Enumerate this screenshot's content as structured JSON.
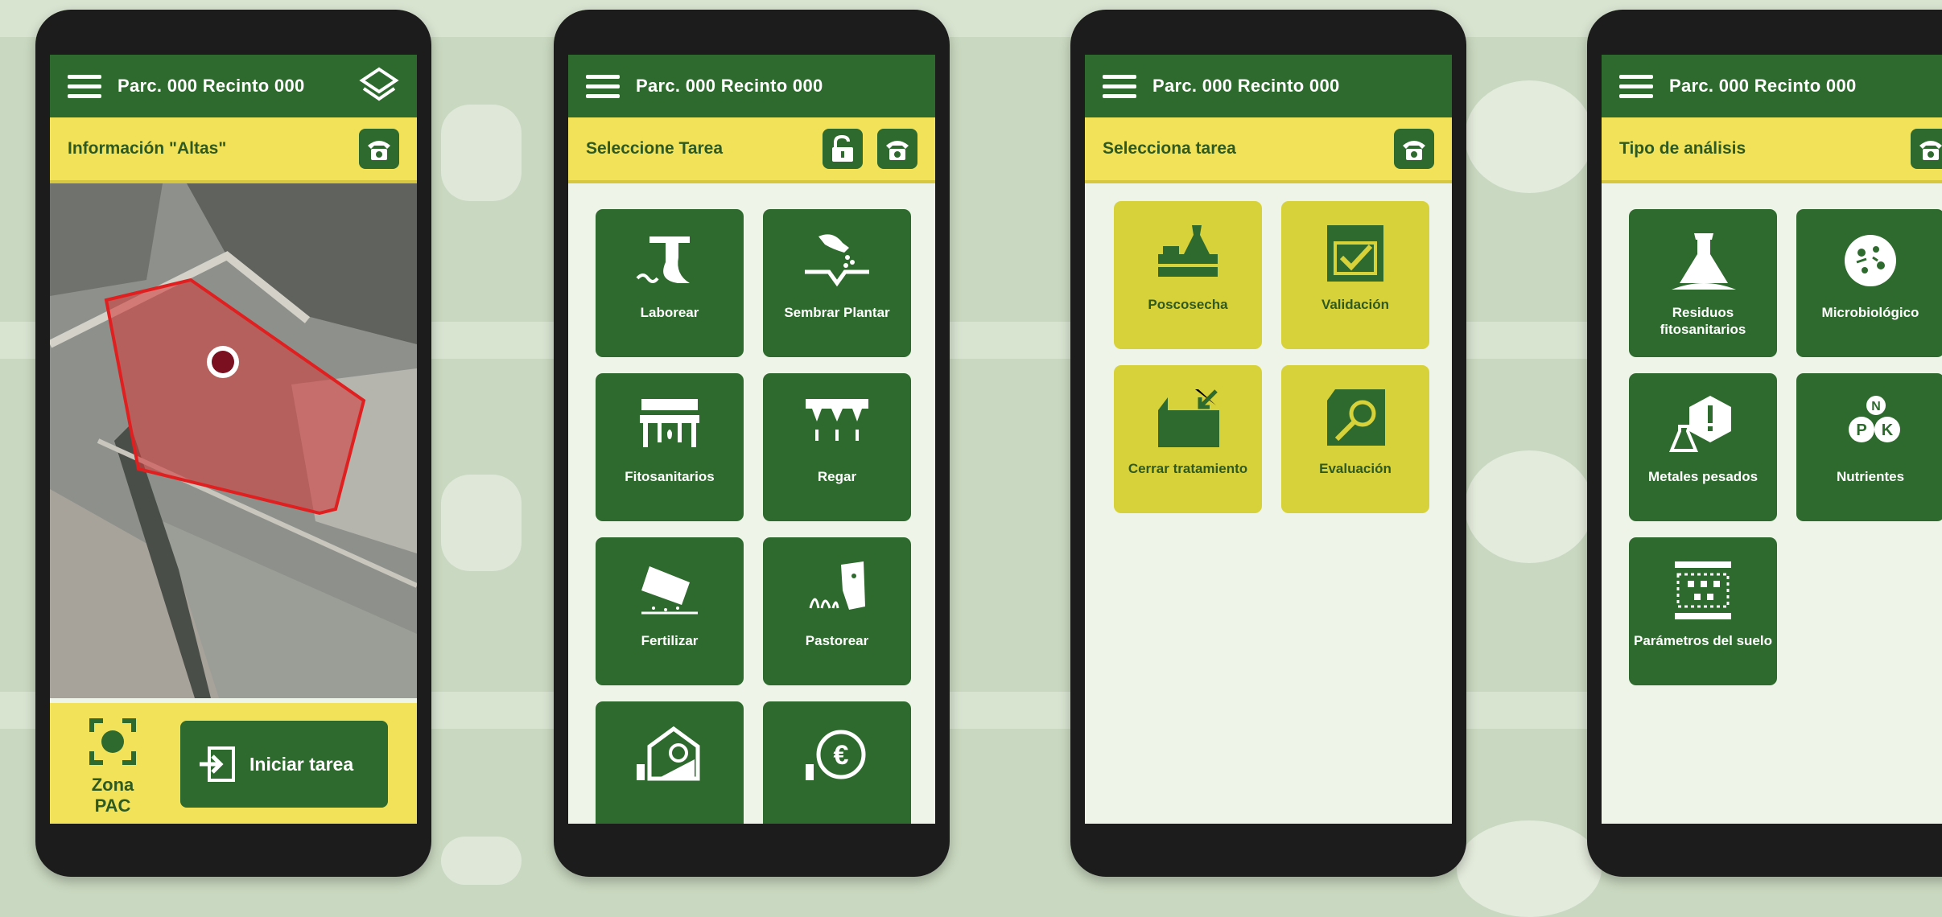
{
  "colors": {
    "dark_green": "#2e6a2e",
    "yellow": "#f1e25a",
    "tile_yellow": "#d8d23a",
    "background": "#c9d8c0",
    "red_parcel": "#d04040"
  },
  "phones": [
    {
      "header": {
        "title": "Parc. 000 Recinto 000"
      },
      "subheader": {
        "title": "Información \"Altas\""
      },
      "footer": {
        "zone_label_line1": "Zona",
        "zone_label_line2": "PAC",
        "start_button": "Iniciar tarea"
      }
    },
    {
      "header": {
        "title": "Parc. 000 Recinto 000"
      },
      "subheader": {
        "title": "Seleccione Tarea"
      },
      "tiles": [
        {
          "label": "Laborear",
          "icon": "plow-icon"
        },
        {
          "label": "Sembrar Plantar",
          "icon": "sow-icon"
        },
        {
          "label": "Fitosanitarios",
          "icon": "sprayer-icon"
        },
        {
          "label": "Regar",
          "icon": "irrigation-icon"
        },
        {
          "label": "Fertilizar",
          "icon": "fertilizer-icon"
        },
        {
          "label": "Pastorear",
          "icon": "grazing-icon"
        },
        {
          "label": "",
          "icon": "storage-icon"
        },
        {
          "label": "",
          "icon": "subsidy-icon"
        }
      ]
    },
    {
      "header": {
        "title": "Parc. 000 Recinto 000"
      },
      "subheader": {
        "title": "Selecciona tarea"
      },
      "tiles": [
        {
          "label": "Poscosecha",
          "icon": "postharvest-icon"
        },
        {
          "label": "Validación",
          "icon": "validation-icon"
        },
        {
          "label": "Cerrar tratamiento",
          "icon": "close-treatment-icon"
        },
        {
          "label": "Evaluación",
          "icon": "evaluation-icon"
        }
      ]
    },
    {
      "header": {
        "title": "Parc. 000 Recinto 000"
      },
      "subheader": {
        "title": "Tipo de análisis"
      },
      "tiles": [
        {
          "label": "Residuos fitosanitarios",
          "icon": "flask-icon"
        },
        {
          "label": "Microbiológico",
          "icon": "microbe-icon"
        },
        {
          "label": "Metales pesados",
          "icon": "heavy-metals-icon"
        },
        {
          "label": "Nutrientes",
          "icon": "npk-icon"
        },
        {
          "label": "Parámetros del suelo",
          "icon": "soil-icon"
        }
      ]
    }
  ]
}
